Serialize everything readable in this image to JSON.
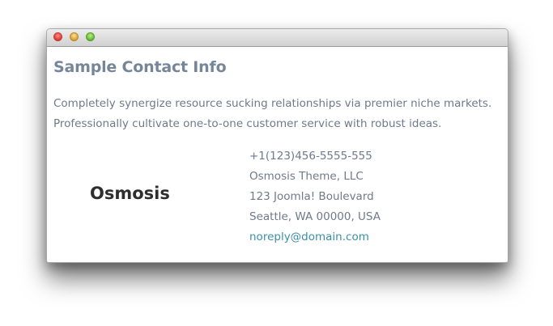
{
  "window": {
    "title_bar_buttons": [
      "close",
      "minimize",
      "zoom"
    ]
  },
  "contact": {
    "heading": "Sample Contact Info",
    "description_lines": [
      "Completely synergize resource sucking relationships via premier niche markets.",
      "Professionally cultivate one-to-one customer service with robust ideas."
    ],
    "brand": "Osmosis",
    "phone": "+1(123)456-5555-555",
    "company": "Osmosis Theme, LLC",
    "street": "123 Joomla! Boulevard",
    "city_state_zip": "Seattle, WA 00000, USA",
    "email": "noreply@domain.com"
  },
  "colors": {
    "heading": "#76869a",
    "body_text": "#6f7a8a",
    "brand": "#2e2e2e",
    "link": "#3b8fa7"
  }
}
